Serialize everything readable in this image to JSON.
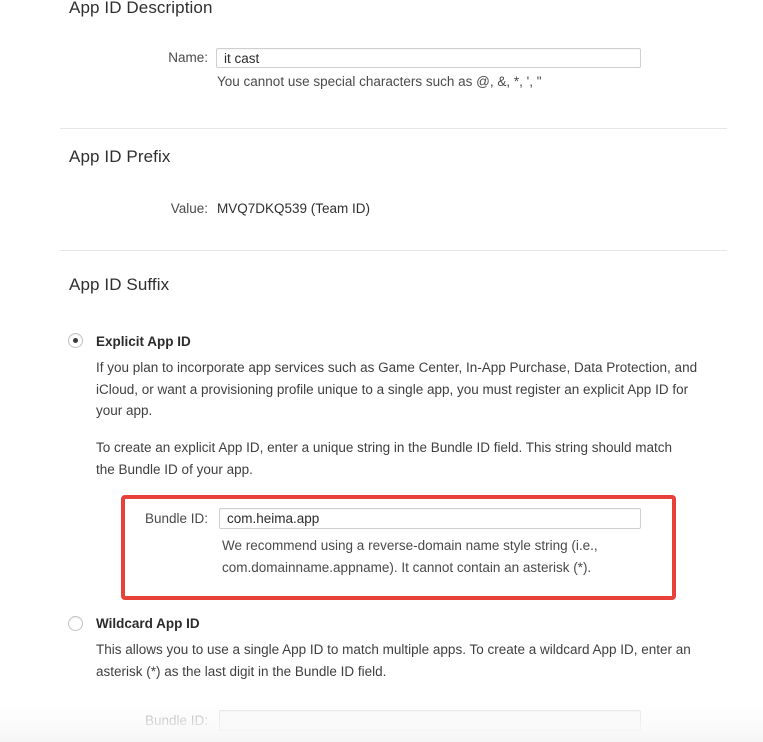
{
  "sections": {
    "description": {
      "heading": "App ID Description",
      "name_label": "Name:",
      "name_value": "it cast",
      "name_hint": "You cannot use special characters such as @, &, *, ', \""
    },
    "prefix": {
      "heading": "App ID Prefix",
      "value_label": "Value:",
      "value": "MVQ7DKQ539 (Team ID)"
    },
    "suffix": {
      "heading": "App ID Suffix",
      "explicit": {
        "title": "Explicit App ID",
        "selected": true,
        "paragraph_1": "If you plan to incorporate app services such as Game Center, In-App Purchase, Data Protection, and iCloud, or want a provisioning profile unique to a single app, you must register an explicit App ID for your app.",
        "paragraph_2": "To create an explicit App ID, enter a unique string in the Bundle ID field. This string should match the Bundle ID of your app.",
        "bundle_label": "Bundle ID:",
        "bundle_value": "com.heima.app",
        "bundle_hint_line_1": "We recommend using a reverse-domain name style string (i.e.,",
        "bundle_hint_line_2": "com.domainname.appname). It cannot contain an asterisk (*)."
      },
      "wildcard": {
        "title": "Wildcard App ID",
        "selected": false,
        "paragraph": "This allows you to use a single App ID to match multiple apps. To create a wildcard App ID, enter an asterisk (*) as the last digit in the Bundle ID field.",
        "bundle_label": "Bundle ID:",
        "bundle_value": "",
        "bundle_placeholder": ""
      }
    }
  },
  "annotation": {
    "highlight_color": "#e8413a"
  }
}
